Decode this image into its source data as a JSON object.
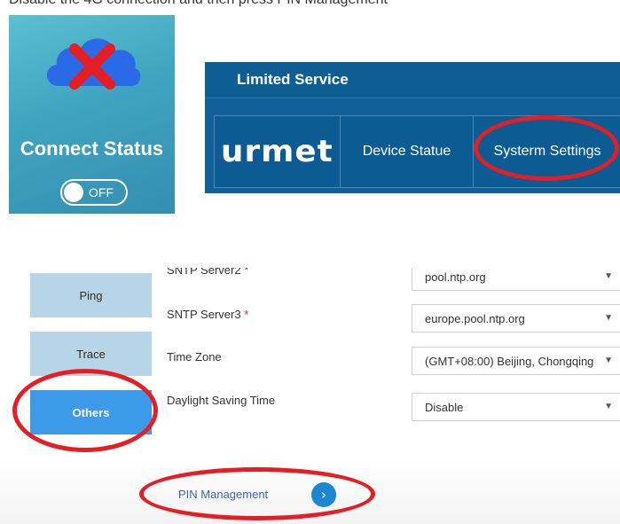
{
  "intro_text": "Disable the 4G connection and then press PIN Management",
  "connect": {
    "label": "Connect Status",
    "toggle_state": "OFF"
  },
  "navbar": {
    "title": "Limited Service",
    "brand": "urmet",
    "tabs": [
      {
        "label": "Device Statue"
      },
      {
        "label": "Systerm Settings"
      }
    ]
  },
  "sidebar": {
    "items": [
      {
        "label": "Ping"
      },
      {
        "label": "Trace"
      },
      {
        "label": "Others"
      }
    ]
  },
  "form": {
    "fields": [
      {
        "label": "SNTP Server2",
        "required": "*",
        "value": "pool.ntp.org"
      },
      {
        "label": "SNTP Server3",
        "required": "*",
        "value": "europe.pool.ntp.org"
      },
      {
        "label": "Time Zone",
        "required": "",
        "value": "(GMT+08:00) Beijing, Chongqing"
      },
      {
        "label": "Daylight Saving Time",
        "required": "",
        "value": "Disable"
      }
    ]
  },
  "pin": {
    "label": "PIN Management",
    "button": "›"
  },
  "colors": {
    "tile": "#3fa4bf",
    "navbar": "#0e5d93",
    "side_btn": "#b8d5e8",
    "side_btn_active": "#3d9ae8",
    "annotation": "#e31e24",
    "cross": "#e31e24",
    "cloud": "#2b6ae6"
  }
}
